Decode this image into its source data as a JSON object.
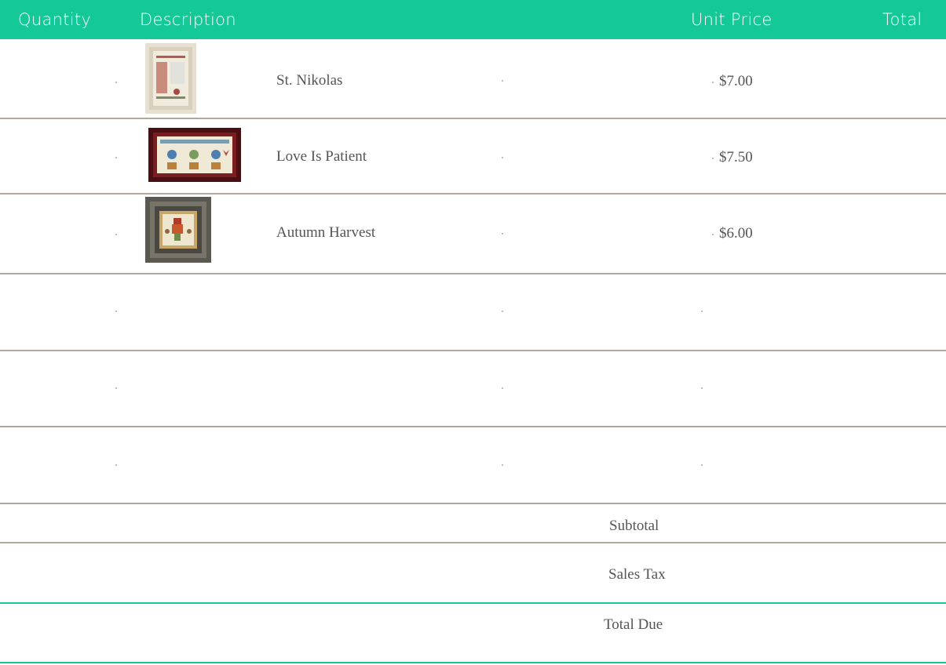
{
  "header": {
    "quantity": "Quantity",
    "description": "Description",
    "unit_price": "Unit Price",
    "total": "Total",
    "bg_color": "#14c997"
  },
  "items": [
    {
      "name": "St. Nikolas",
      "unit_price": "$7.00",
      "image": "st-nikolas-sampler-image"
    },
    {
      "name": "Love Is Patient",
      "unit_price": "$7.50",
      "image": "love-is-patient-sampler-image"
    },
    {
      "name": "Autumn Harvest",
      "unit_price": "$6.00",
      "image": "autumn-harvest-sampler-image"
    }
  ],
  "summary": {
    "subtotal": "Subtotal",
    "sales_tax": "Sales Tax",
    "total_due": "Total Due"
  }
}
